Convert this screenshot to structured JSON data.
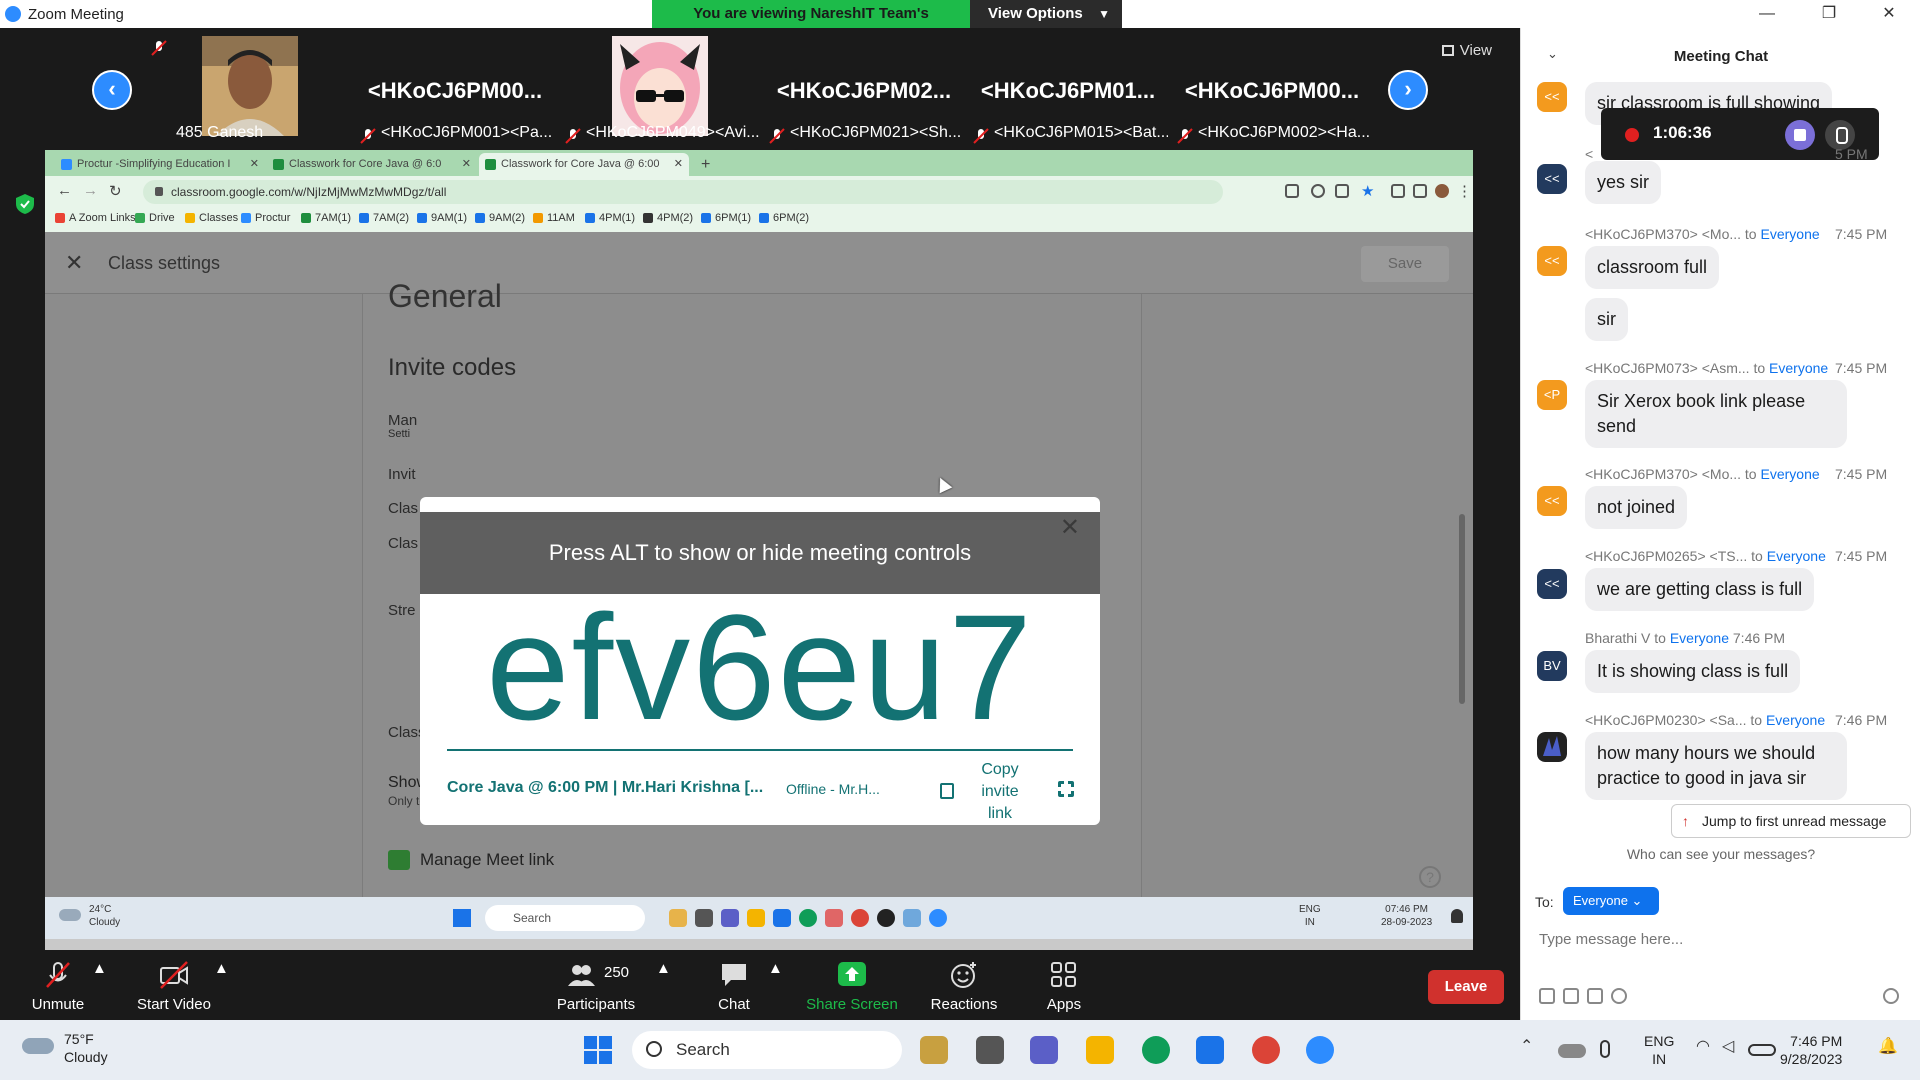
{
  "window": {
    "title": "Zoom Meeting",
    "share_banner": "You are viewing NareshIT Team's screen",
    "view_options": "View Options"
  },
  "gallery": {
    "view_label": "View",
    "tiles": [
      {
        "label": "485 Ganesh",
        "name": ""
      },
      {
        "label": "<HKoCJ6PM001><Pa...",
        "name": "<HKoCJ6PM00..."
      },
      {
        "label": "<HKoCJ6PM049><Avi...",
        "name": ""
      },
      {
        "label": "<HKoCJ6PM021><Sh...",
        "name": "<HKoCJ6PM02..."
      },
      {
        "label": "<HKoCJ6PM015><Bat...",
        "name": "<HKoCJ6PM01..."
      },
      {
        "label": "<HKoCJ6PM002><Ha...",
        "name": "<HKoCJ6PM00..."
      }
    ]
  },
  "browser": {
    "tabs": [
      {
        "label": "Proctur -Simplifying Education I"
      },
      {
        "label": "Classwork for Core Java @ 6:0"
      },
      {
        "label": "Classwork for Core Java @ 6:00"
      }
    ],
    "url": "classroom.google.com/w/NjIzMjMwMzMwMDgz/t/all",
    "bookmarks": [
      "A Zoom Links",
      "Drive",
      "Classes",
      "Proctur",
      "7AM(1)",
      "7AM(2)",
      "9AM(1)",
      "9AM(2)",
      "11AM",
      "4PM(1)",
      "4PM(2)",
      "6PM(1)",
      "6PM(2)"
    ]
  },
  "classroom": {
    "page_title": "Class settings",
    "save_label": "Save",
    "section_cut": "General",
    "invite_codes": "Invite codes",
    "partials": [
      "Man",
      "Setti",
      "Invit",
      "Clas",
      "Clas",
      "Stre",
      "Classwork on the stream"
    ],
    "show_deleted_title": "Show deleted items",
    "show_deleted_sub": "Only teachers can view deleted items.",
    "manage_meet": "Manage Meet link",
    "help": "?"
  },
  "modal": {
    "code": "efv6eu7",
    "class_name": "Core Java @ 6:00 PM | Mr.Hari Krishna [...",
    "offline": "Offline - Mr.H...",
    "copy_label": "Copy invite link"
  },
  "alt_overlay": "Press ALT to show or hide meeting controls",
  "inner_taskbar": {
    "temp": "24°C",
    "condition": "Cloudy",
    "search": "Search",
    "lang1": "ENG",
    "lang2": "IN",
    "time": "07:46 PM",
    "date": "28-09-2023"
  },
  "controls": {
    "unmute": "Unmute",
    "start_video": "Start Video",
    "participants": "Participants",
    "participants_count": "250",
    "chat": "Chat",
    "share_screen": "Share Screen",
    "reactions": "Reactions",
    "apps": "Apps",
    "leave": "Leave"
  },
  "chat": {
    "title": "Meeting Chat",
    "recording_time": "1:06:36",
    "messages": [
      {
        "header": "",
        "to": "",
        "time": "",
        "avatar": "<<",
        "text": "sir classroom is full showing"
      },
      {
        "header": "<",
        "to": "",
        "time": "5 PM",
        "avatar": "<<",
        "text": "yes sir"
      },
      {
        "header": "<HKoCJ6PM370> <Mo...",
        "to": "Everyone",
        "time": "7:45 PM",
        "avatar": "<<",
        "text": "classroom full"
      },
      {
        "header": "",
        "to": "",
        "time": "",
        "avatar": "",
        "text": "sir"
      },
      {
        "header": "<HKoCJ6PM073> <Asm...",
        "to": "Everyone",
        "time": "7:45 PM",
        "avatar": "<P",
        "text": "Sir Xerox book link please send"
      },
      {
        "header": "<HKoCJ6PM370> <Mo...",
        "to": "Everyone",
        "time": "7:45 PM",
        "avatar": "<<",
        "text": "not joined"
      },
      {
        "header": "<HKoCJ6PM0265> <TS...",
        "to": "Everyone",
        "time": "7:45 PM",
        "avatar": "<<",
        "text": "we are getting class is full"
      },
      {
        "header": "Bharathi V",
        "to": "Everyone",
        "time": "7:46 PM",
        "avatar": "BV",
        "text": "It is showing class is full"
      },
      {
        "header": "<HKoCJ6PM0230> <Sa...",
        "to": "Everyone",
        "time": "7:46 PM",
        "avatar": "",
        "text": "how many hours we should practice to good in java sir"
      }
    ],
    "to_word": "to",
    "jump_label": "Jump to first unread message",
    "who_can_see": "Who can see your messages?",
    "to_label": "To:",
    "to_target": "Everyone",
    "input_placeholder": "Type message here..."
  },
  "taskbar": {
    "temp": "75°F",
    "condition": "Cloudy",
    "search": "Search",
    "lang1": "ENG",
    "lang2": "IN",
    "time": "7:46 PM",
    "date": "9/28/2023"
  },
  "colors": {
    "zoom_blue": "#2d8cff",
    "share_green": "#1dbb4a",
    "leave_red": "#d0312d",
    "classroom_teal": "#137273",
    "avatar_orange": "#f39a1e"
  }
}
